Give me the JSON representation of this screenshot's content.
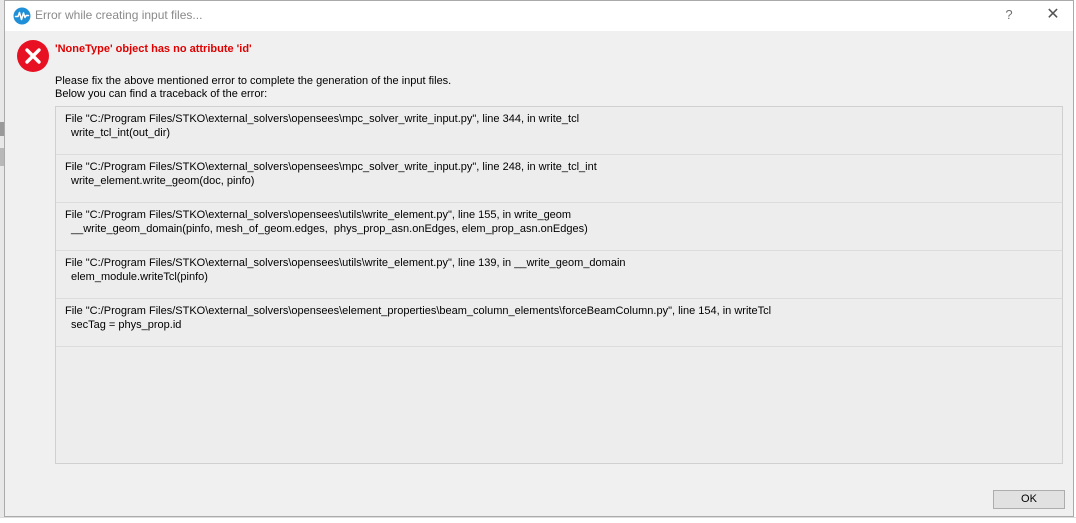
{
  "window": {
    "title": "Error while creating input files...",
    "help_label": "?",
    "close_label": "✕"
  },
  "error": {
    "title": "'NoneType' object has no attribute 'id'",
    "message_line1": "Please fix the above mentioned error to complete the generation of the input files.",
    "message_line2": "Below you can find a traceback of the error:"
  },
  "traceback": [
    {
      "file_line": "File \"C:/Program Files/STKO\\external_solvers\\opensees\\mpc_solver_write_input.py\", line 344, in write_tcl",
      "code_line": "write_tcl_int(out_dir)"
    },
    {
      "file_line": "File \"C:/Program Files/STKO\\external_solvers\\opensees\\mpc_solver_write_input.py\", line 248, in write_tcl_int",
      "code_line": "write_element.write_geom(doc, pinfo)"
    },
    {
      "file_line": "File \"C:/Program Files/STKO\\external_solvers\\opensees\\utils\\write_element.py\", line 155, in write_geom",
      "code_line": "__write_geom_domain(pinfo, mesh_of_geom.edges,  phys_prop_asn.onEdges, elem_prop_asn.onEdges)"
    },
    {
      "file_line": "File \"C:/Program Files/STKO\\external_solvers\\opensees\\utils\\write_element.py\", line 139, in __write_geom_domain",
      "code_line": "elem_module.writeTcl(pinfo)"
    },
    {
      "file_line": "File \"C:/Program Files/STKO\\external_solvers\\opensees\\element_properties\\beam_column_elements\\forceBeamColumn.py\", line 154, in writeTcl",
      "code_line": "secTag = phys_prop.id"
    }
  ],
  "buttons": {
    "ok_label": "OK"
  },
  "colors": {
    "error_red": "#e00000",
    "icon_red": "#e81123",
    "app_icon_blue": "#1f8fd8"
  },
  "icons": {
    "app": "waveform-icon",
    "error": "error-circle-x-icon"
  }
}
